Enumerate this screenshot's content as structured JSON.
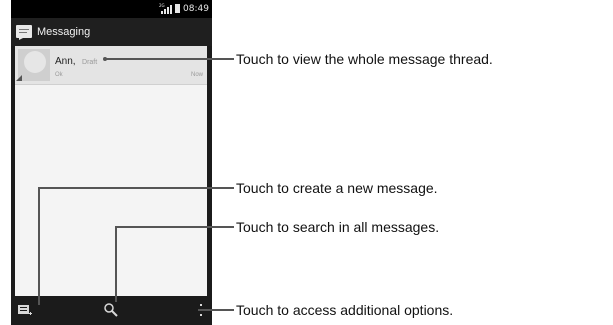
{
  "status_bar": {
    "time": "08:49",
    "network": "2G"
  },
  "action_bar": {
    "title": "Messaging"
  },
  "thread": {
    "name": "Ann",
    "separator": ",",
    "draft_label": "Draft",
    "snippet": "Ok",
    "timestamp": "Now"
  },
  "callouts": {
    "thread": "Touch to view the whole message thread.",
    "new_message": "Touch to create a new message.",
    "search": "Touch to search in all messages.",
    "options": "Touch to access additional options."
  },
  "icons": {
    "app": "messaging-icon",
    "new": "new-message-icon",
    "search": "search-icon",
    "more": "overflow-menu-icon"
  },
  "colors": {
    "phone_bg": "#1b1b1b",
    "list_bg": "#f4f4f4",
    "thread_bg": "#e4e4e4"
  }
}
